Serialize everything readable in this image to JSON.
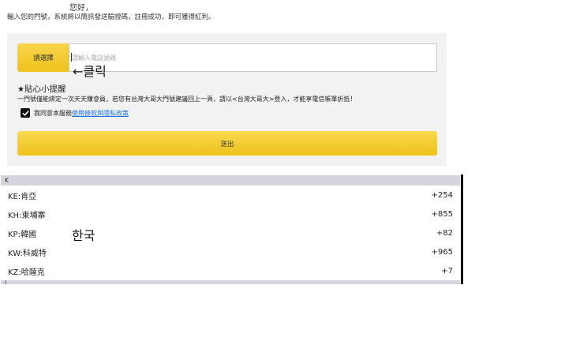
{
  "greeting": "您好，",
  "instruction": "輸入您的門號，系統將以簡訊發送驗證碼，註冊成功，即可獲得紅利。",
  "form": {
    "select_label": "請選擇",
    "phone_placeholder": "請輸入電話號碼",
    "click_annotation": "←클릭",
    "tip_star": "★",
    "tip_title": "貼心小提醒",
    "tip_text": "一門號僅能綁定一次天天賺會員，若您有台灣大哥大門號建議回上一頁，請以<台灣大哥大>登入，才能享電信帳單折抵！",
    "agree_text": "我同意本服務",
    "agree_link": "使用條款與隱私政策",
    "agree_checked": true,
    "submit_label": "送出"
  },
  "country_list": {
    "section_label": "K",
    "section_label_next": "L",
    "rows": [
      {
        "name": "KE:肯亞",
        "code": "+254"
      },
      {
        "name": "KH:柬埔寨",
        "code": "+855"
      },
      {
        "name": "KP:韓國",
        "code": "+82"
      },
      {
        "name": "KW:科威特",
        "code": "+965"
      },
      {
        "name": "KZ:哈薩克",
        "code": "+7"
      }
    ],
    "korean_annotation": "한국"
  },
  "colors": {
    "button_yellow": "#f2c62a",
    "link_blue": "#1a73e8",
    "section_header": "#d5d5e0"
  }
}
